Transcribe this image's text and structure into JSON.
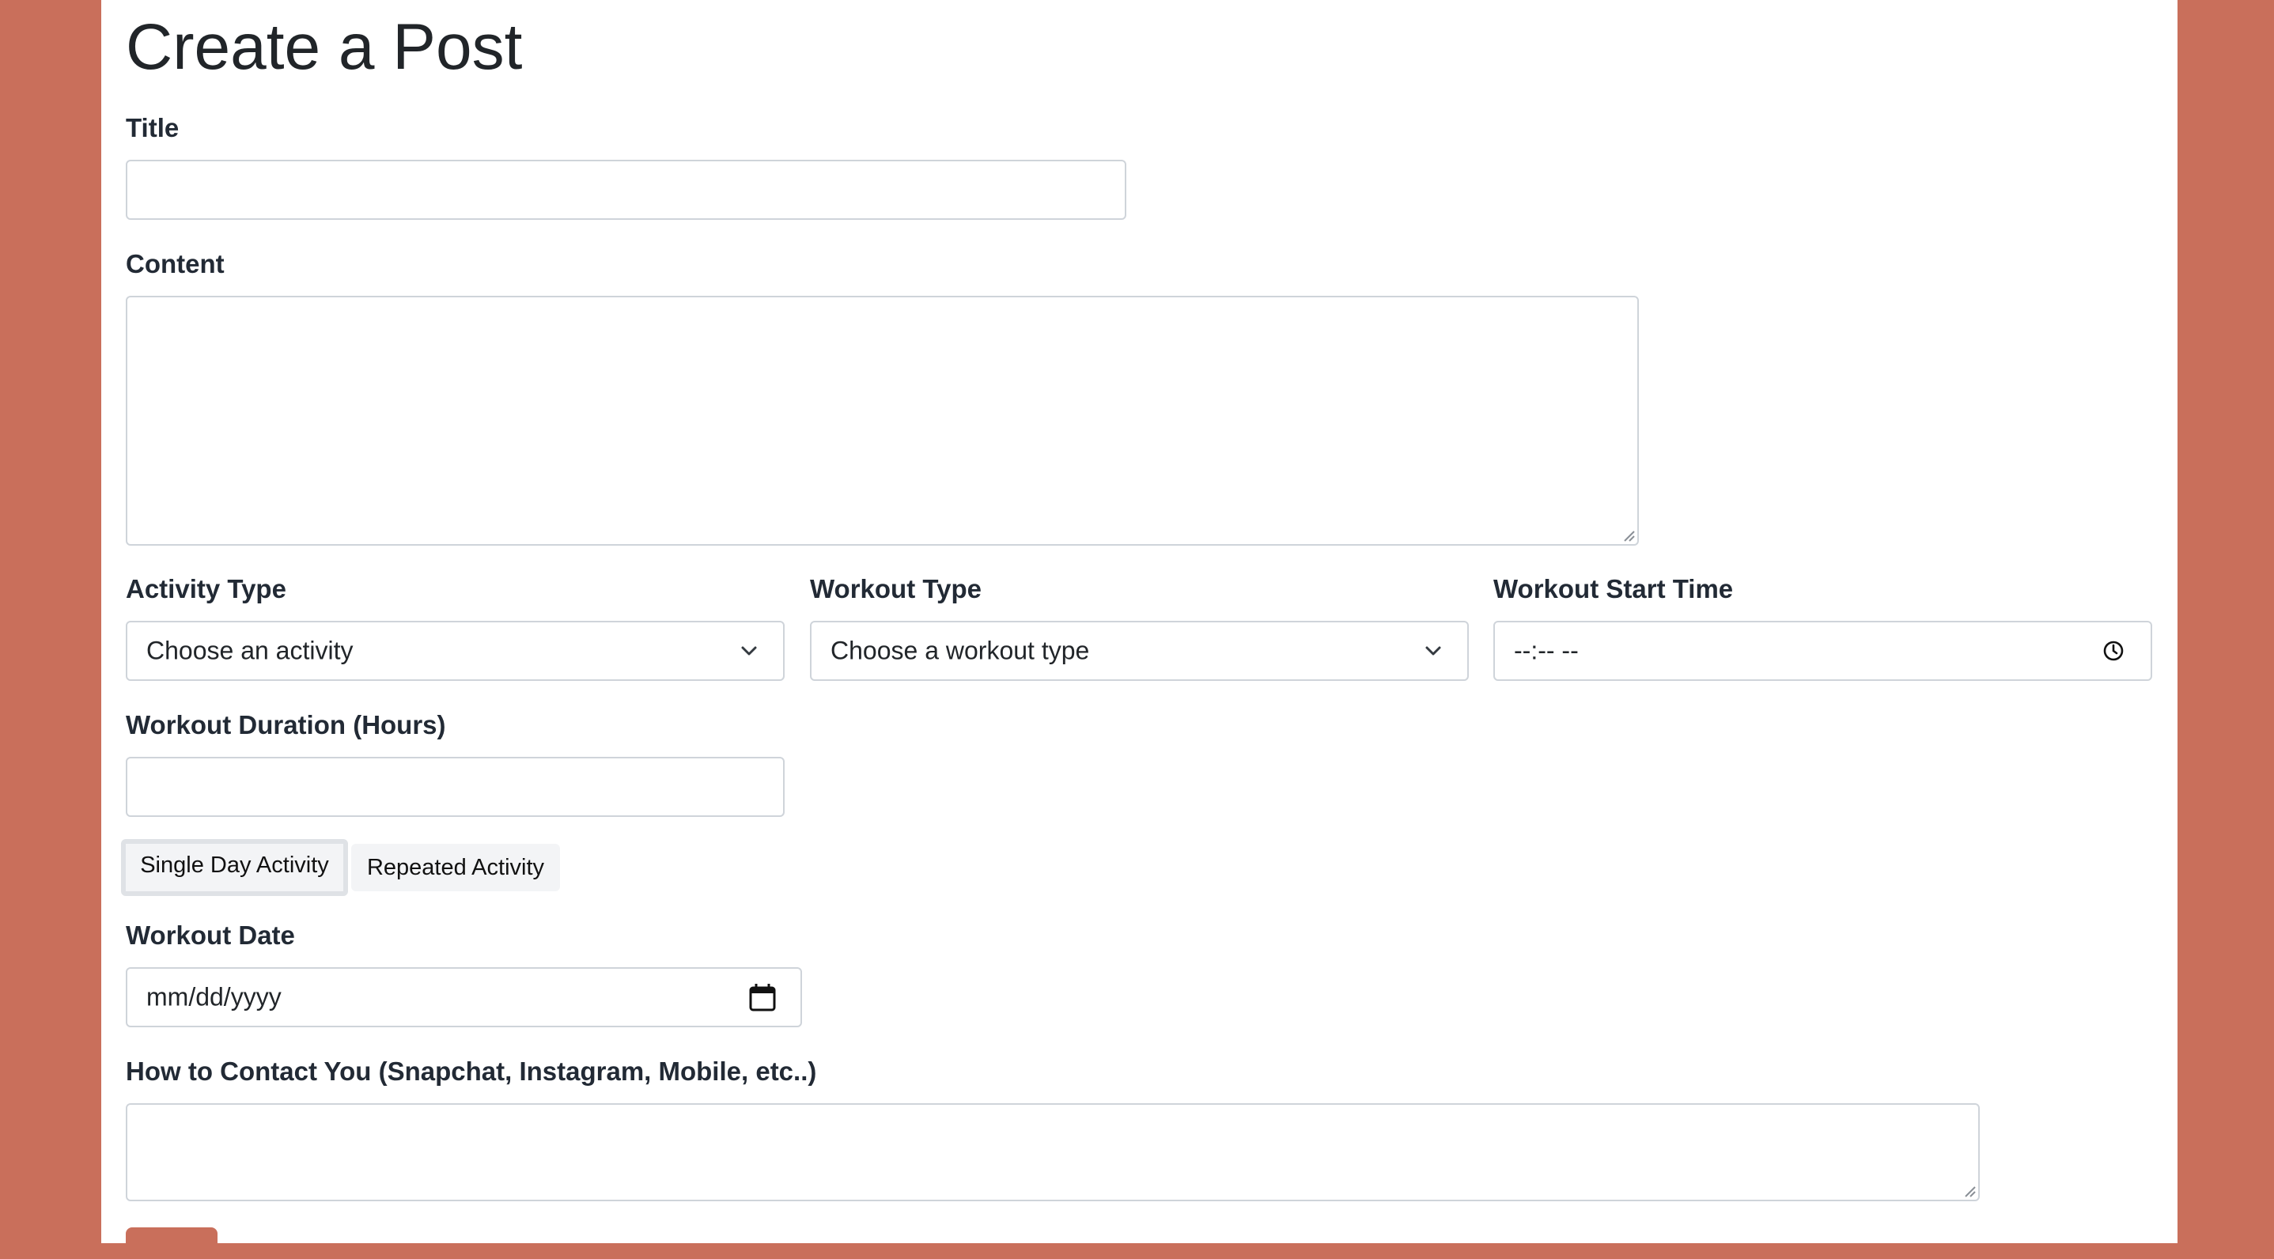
{
  "page": {
    "title": "Create a Post"
  },
  "form": {
    "title_label": "Title",
    "title_value": "",
    "content_label": "Content",
    "content_value": "",
    "activity_type_label": "Activity Type",
    "activity_type_selected": "Choose an activity",
    "workout_type_label": "Workout Type",
    "workout_type_selected": "Choose a workout type",
    "start_time_label": "Workout Start Time",
    "start_time_value": "--:-- --",
    "duration_label": "Workout Duration (Hours)",
    "duration_value": "",
    "single_day_label": "Single Day Activity",
    "repeated_label": "Repeated Activity",
    "selected_mode": "Single Day Activity",
    "date_label": "Workout Date",
    "date_value": "mm/dd/yyyy",
    "contact_label": "How to Contact You (Snapchat, Instagram, Mobile, etc..)",
    "contact_value": ""
  },
  "colors": {
    "background": "#c96f5b",
    "panel": "#ffffff",
    "text": "#222a35",
    "border": "#cfd4da",
    "button": "#c96f5b"
  },
  "icons": {
    "select_arrow": "chevron-down-icon",
    "time_picker": "clock-icon",
    "date_picker": "calendar-icon",
    "textarea_resize": "resize-grip-icon"
  }
}
